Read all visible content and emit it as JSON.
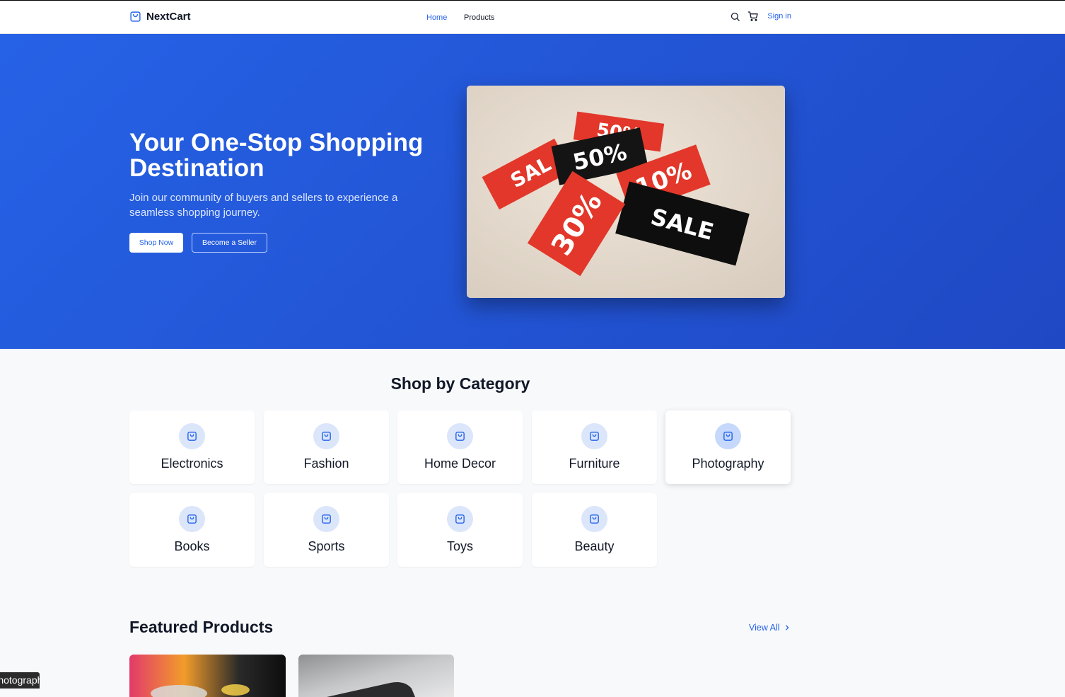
{
  "header": {
    "brand": "NextCart",
    "nav": [
      {
        "label": "Home",
        "active": true
      },
      {
        "label": "Products",
        "active": false
      }
    ],
    "sign_in": "Sign in",
    "icons": [
      "search-icon",
      "cart-icon",
      "shopping-bag-icon"
    ]
  },
  "hero": {
    "title": "Your One-Stop Shopping Destination",
    "subtitle": "Join our community of buyers and sellers to experience a seamless shopping journey.",
    "primary_button": "Shop Now",
    "secondary_button": "Become a Seller",
    "image_tags": [
      "50%",
      "SAL",
      "50%",
      "10%",
      "30%",
      "SALE"
    ]
  },
  "categories": {
    "title": "Shop by Category",
    "items": [
      "Electronics",
      "Fashion",
      "Home Decor",
      "Furniture",
      "Photography",
      "Books",
      "Sports",
      "Toys",
      "Beauty"
    ]
  },
  "featured": {
    "title": "Featured Products",
    "view_all": "View All"
  },
  "tooltip": "Photography",
  "colors": {
    "accent": "#2563eb",
    "hero_start": "#2662e6",
    "hero_end": "#1f48c4"
  }
}
